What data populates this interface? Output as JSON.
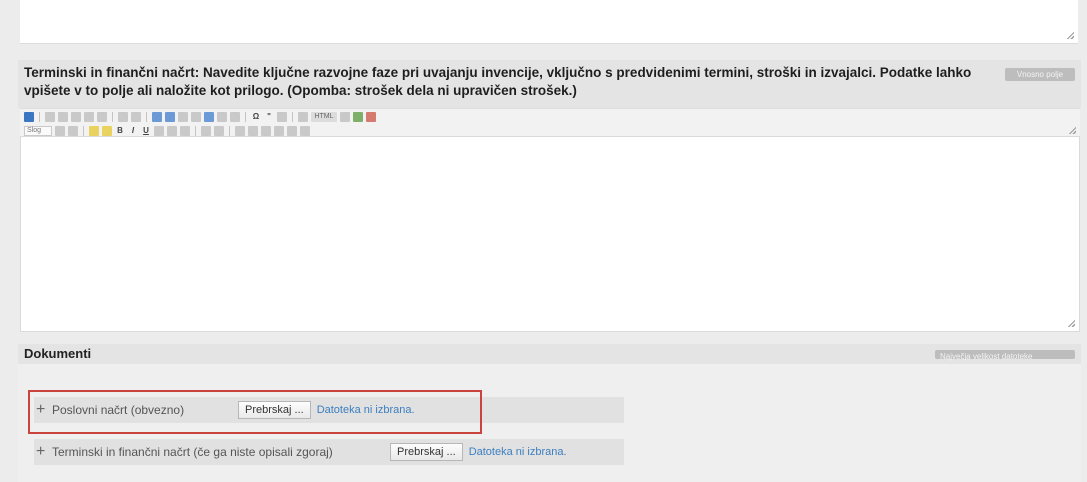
{
  "question": {
    "text": "Terminski in finančni načrt: Navedite ključne razvojne faze pri uvajanju invencije, vključno s predvidenimi termini, stroški in izvajalci. Podatke lahko vpišete v to polje ali naložite kot prilogo. (Opomba: strošek dela ni upravičen strošek.)",
    "badge": "Vnosno polje"
  },
  "editor": {
    "style_dropdown": "Slog",
    "html_label": "HTML",
    "bold_label": "B",
    "italic_label": "I",
    "underline_label": "U"
  },
  "documents": {
    "title": "Dokumenti",
    "badge": "Največja velikost datoteke",
    "items": [
      {
        "label": "Poslovni načrt (obvezno)",
        "browse_label": "Prebrskaj ...",
        "status": "Datoteka ni izbrana."
      },
      {
        "label": "Terminski in finančni načrt (če ga niste opisali zgoraj)",
        "browse_label": "Prebrskaj ...",
        "status": "Datoteka ni izbrana."
      }
    ]
  },
  "highlight_color": "#c9443f"
}
